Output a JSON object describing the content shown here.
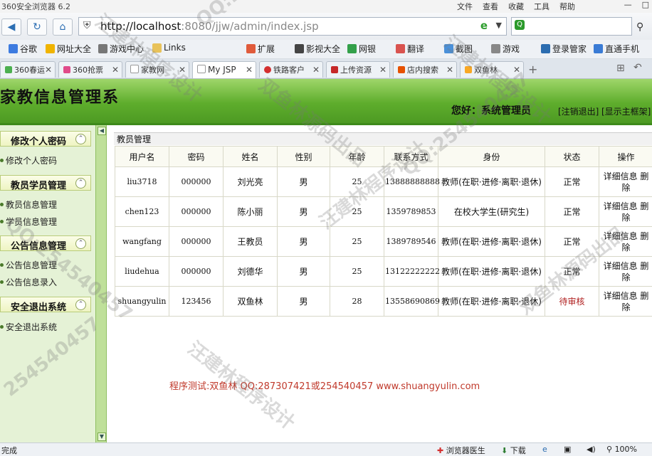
{
  "browser": {
    "window_title": "360安全浏览器 6.2",
    "menus": [
      "文件",
      "查看",
      "收藏",
      "工具",
      "帮助"
    ],
    "url_host": "http://localhost",
    "url_rest": ":8080/jjw/admin/index.jsp",
    "bookmarks": [
      "谷歌",
      "网址大全",
      "游戏中心",
      "Links"
    ],
    "toolbar_right": [
      "扩展",
      "影视大全",
      "网银",
      "翻译",
      "截图",
      "游戏",
      "登录管家",
      "直通手机"
    ],
    "tabs": [
      "360春运",
      "360抢票",
      "家教网",
      "My JSP",
      "铁路客户",
      "上传资源",
      "店内搜索",
      "双鱼林"
    ],
    "status_left": "完成",
    "status_right": [
      "浏览器医生",
      "下载",
      "100%"
    ]
  },
  "header": {
    "title": "家教信息管理系",
    "greeting": "您好：系统管理员",
    "logout_link": "[注销退出]",
    "frame_link": "[显示主框架]"
  },
  "sidebar": {
    "sections": [
      {
        "title": "修改个人密码",
        "items": [
          "修改个人密码"
        ]
      },
      {
        "title": "教员学员管理",
        "items": [
          "教员信息管理",
          "学员信息管理"
        ]
      },
      {
        "title": "公告信息管理",
        "items": [
          "公告信息管理",
          "公告信息录入"
        ]
      },
      {
        "title": "安全退出系统",
        "items": [
          "安全退出系统"
        ]
      }
    ]
  },
  "main": {
    "panel_title": "教员管理",
    "columns": [
      "用户名",
      "密码",
      "姓名",
      "性别",
      "年龄",
      "联系方式",
      "身份",
      "状态",
      "操作"
    ],
    "rows": [
      {
        "username": "liu3718",
        "password": "000000",
        "name": "刘光亮",
        "gender": "男",
        "age": "25",
        "contact": "13888888888",
        "identity": "教师(在职·进修·离职·退休)",
        "status": "正常",
        "action": "详细信息 删除"
      },
      {
        "username": "chen123",
        "password": "000000",
        "name": "陈小丽",
        "gender": "男",
        "age": "25",
        "contact": "1359789853",
        "identity": "在校大学生(研究生)",
        "status": "正常",
        "action": "详细信息 删除"
      },
      {
        "username": "wangfang",
        "password": "000000",
        "name": "王教员",
        "gender": "男",
        "age": "25",
        "contact": "1389789546",
        "identity": "教师(在职·进修·离职·退休)",
        "status": "正常",
        "action": "详细信息 删除"
      },
      {
        "username": "liudehua",
        "password": "000000",
        "name": "刘德华",
        "gender": "男",
        "age": "25",
        "contact": "13122222222",
        "identity": "教师(在职·进修·离职·退休)",
        "status": "正常",
        "action": "详细信息 删除"
      },
      {
        "username": "shuangyulin",
        "password": "123456",
        "name": "双鱼林",
        "gender": "男",
        "age": "28",
        "contact": "13558690869",
        "identity": "教师(在职·进修·离职·退休)",
        "status": "待审核",
        "action": "详细信息 删除"
      }
    ],
    "footer_note": "程序测试:双鱼林 QQ:287307421或254540457 www.shuangyulin.com"
  },
  "watermarks": [
    "汪建林程序设计",
    "QQ:254540457",
    "双鱼林源码出品",
    "254540457"
  ],
  "colors": {
    "header_green": "#5ead2c",
    "sidebar_bg": "#e5f2d6",
    "pending_status": "#b02020",
    "footer_text": "#c0392b"
  }
}
